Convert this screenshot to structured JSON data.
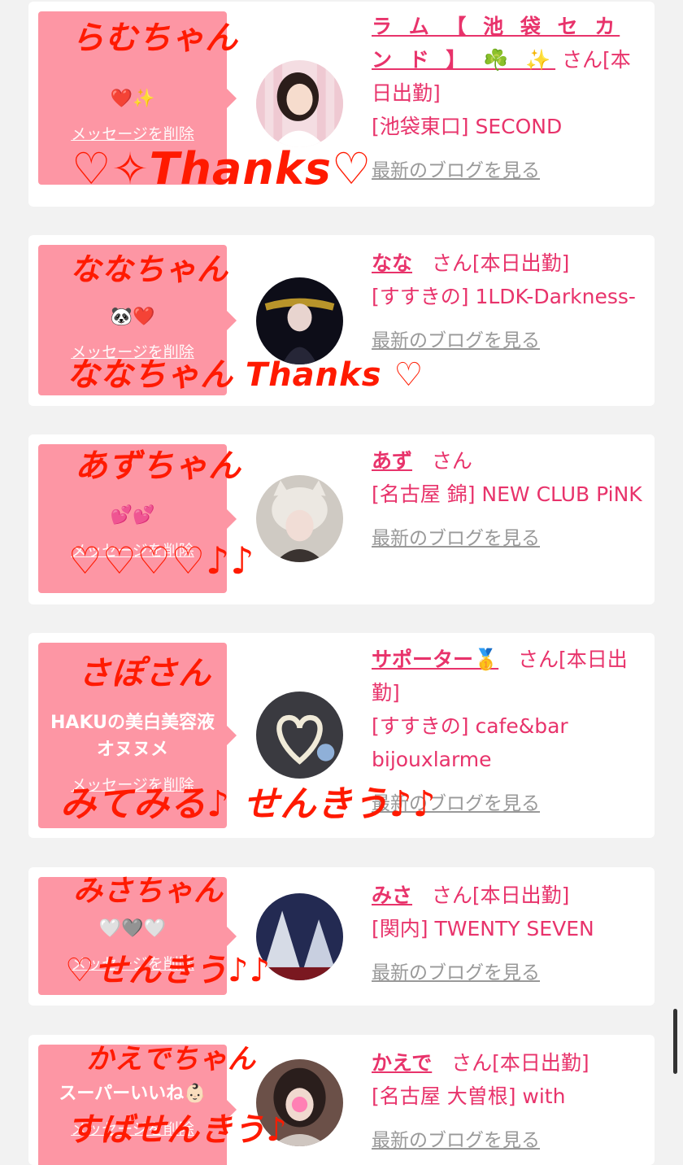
{
  "cards": [
    {
      "bubble_msg": "❤️✨",
      "delete_label": "メッセージを削除",
      "name": "ラ ム 【 池 袋 セ カ ン ド 】 ☘️ ✨",
      "suffix": "さん[本日出勤]",
      "shop": "[池袋東口] SECOND",
      "blog_label": "最新のブログを見る",
      "handwriting_top": "らむちゃん",
      "handwriting_bottom": "♡✧Thanks♡"
    },
    {
      "bubble_msg": "🐼❤️",
      "delete_label": "メッセージを削除",
      "name": "なな",
      "suffix": "さん[本日出勤]",
      "shop": "[すすきの] 1LDK-Darkness-",
      "blog_label": "最新のブログを見る",
      "handwriting_top": "ななちゃん",
      "handwriting_bottom": "ななちゃん Thanks ♡"
    },
    {
      "bubble_msg": "💕💕",
      "delete_label": "メッセージを削除",
      "name": "あず",
      "suffix": "さん",
      "shop": "[名古屋 錦] NEW CLUB PiNK",
      "blog_label": "最新のブログを見る",
      "handwriting_top": "あずちゃん",
      "handwriting_bottom": "♡♡♡♡♪♪"
    },
    {
      "bubble_msg": "HAKUの美白美容液オヌヌメ",
      "delete_label": "メッセージを削除",
      "name": "サポーター🥇",
      "suffix": "さん[本日出勤]",
      "shop": "[すすきの] cafe&bar bijouxlarme",
      "blog_label": "最新のブログを見る",
      "handwriting_top": "さぽさん",
      "handwriting_bottom": "みてみる♪ せんきう♪♪"
    },
    {
      "bubble_msg": "🤍🩶🤍",
      "delete_label": "メッセージを削除",
      "name": "みさ",
      "suffix": "さん[本日出勤]",
      "shop": "[関内] TWENTY SEVEN",
      "blog_label": "最新のブログを見る",
      "handwriting_top": "みさちゃん",
      "handwriting_bottom": "♡せんきう♪♪"
    },
    {
      "bubble_msg": "スーパーいいね👶🏻",
      "delete_label": "メッセージを削除",
      "name": "かえで",
      "suffix": "さん[本日出勤]",
      "shop": "[名古屋 大曽根] with",
      "blog_label": "最新のブログを見る",
      "handwriting_top": "かえでちゃん",
      "handwriting_bottom": "すばせんきう♪"
    }
  ],
  "colors": {
    "page_bg": "#f2f2f2",
    "bubble": "#fd96a4",
    "name_pink": "#e8336b",
    "blog_gray": "#999999",
    "handwriting_red": "#ff1a00"
  }
}
